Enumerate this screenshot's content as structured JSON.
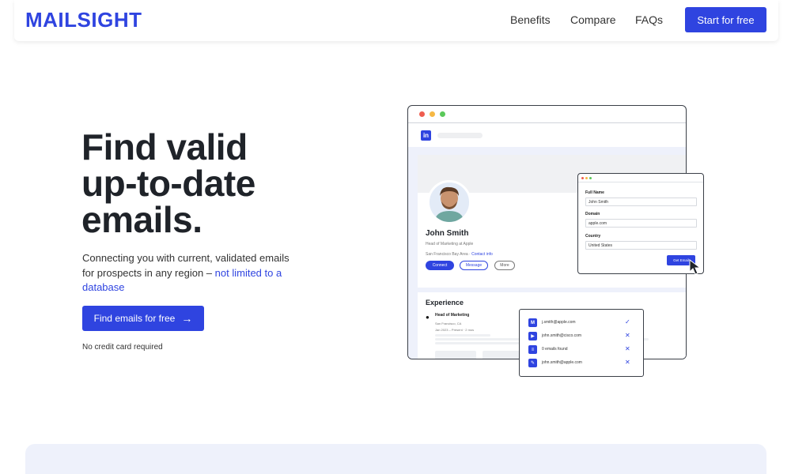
{
  "header": {
    "logo": "MAILSIGHT",
    "nav": [
      "Benefits",
      "Compare",
      "FAQs"
    ],
    "cta": "Start for free"
  },
  "hero": {
    "title_line1": "Find valid",
    "title_line2": "up-to-date",
    "title_line3": "emails.",
    "subtitle_text": "Connecting you with current, validated emails for prospects in any region – ",
    "subtitle_link": "not limited to a database",
    "cta": "Find emails for free",
    "cta_icon": "arrow-right-icon",
    "note": "No credit card required"
  },
  "profile": {
    "logo": "in",
    "name": "John Smith",
    "title": "Head of Marketing at Apple",
    "location": "San Francisco Bay Area",
    "contact_info": "Contact info",
    "buttons": [
      "Connect",
      "Message",
      "More"
    ],
    "experience_heading": "Experience",
    "experience": {
      "role": "Head of Marketing",
      "location": "San Francisco, CA",
      "dates": "Jan 2023 – Present · 2 mos"
    }
  },
  "form": {
    "fields": [
      {
        "label": "Full Name",
        "value": "John Smith"
      },
      {
        "label": "Domain",
        "value": "apple.com"
      },
      {
        "label": "Country",
        "value": "United States"
      }
    ],
    "button": "Get Email"
  },
  "results": [
    {
      "icon": "M",
      "text": "j.smith@apple.com",
      "status": "✓"
    },
    {
      "icon": "▶",
      "text": "john.smith@cisco.com",
      "status": "✕"
    },
    {
      "icon": "≡",
      "text": "0 emails found",
      "status": "✕"
    },
    {
      "icon": "✎",
      "text": "john.smith@apple.com",
      "status": "✕"
    }
  ],
  "colors": {
    "brand": "#2f44e0",
    "text": "#1f2329",
    "band": "#eef1fb"
  }
}
